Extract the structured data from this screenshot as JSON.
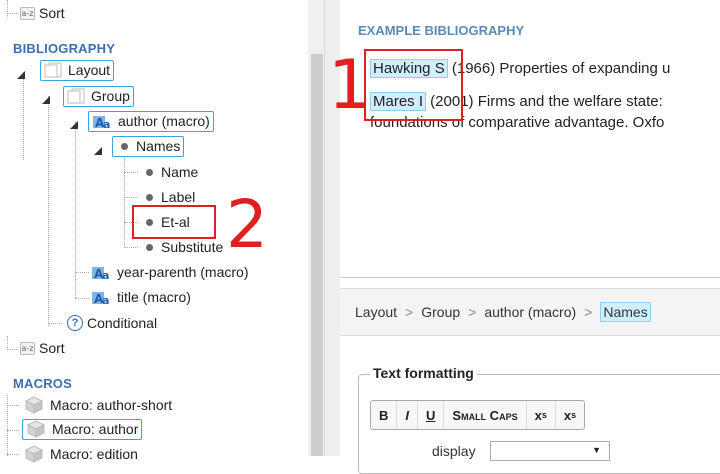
{
  "tree": {
    "sort_top": "Sort",
    "bibliography_title": "BIBLIOGRAPHY",
    "layout": "Layout",
    "group": "Group",
    "author_macro": "author (macro)",
    "names": "Names",
    "name": "Name",
    "label": "Label",
    "et_al": "Et-al",
    "substitute": "Substitute",
    "year_parenth": "year-parenth (macro)",
    "title_macro": "title (macro)",
    "conditional": "Conditional",
    "sort_bottom": "Sort",
    "macros_title": "MACROS",
    "macro_author_short": "Macro: author-short",
    "macro_author": "Macro: author",
    "macro_edition": "Macro: edition",
    "az_icon_text": "a-z",
    "help_icon_text": "?"
  },
  "preview": {
    "title": "EXAMPLE BIBLIOGRAPHY",
    "entries": [
      {
        "author": "Hawking S",
        "rest": " (1966) Properties of expanding u"
      },
      {
        "author": "Mares I",
        "rest": " (2001) Firms and the welfare state: "
      }
    ],
    "continuation": "foundations of comparative advantage. Oxfo"
  },
  "breadcrumb": {
    "items": [
      "Layout",
      "Group",
      "author (macro)",
      "Names"
    ],
    "separator": ">"
  },
  "editor": {
    "legend": "Text formatting",
    "buttons": {
      "bold": "B",
      "italic": "I",
      "underline": "U",
      "small_caps": "Small Caps",
      "superscript": "x",
      "superscript_mark": "s",
      "subscript": "x",
      "subscript_mark": "s"
    },
    "display_label": "display",
    "display_value": "",
    "dropdown_arrow": "▼"
  },
  "annotations": {
    "one": "1",
    "two": "2",
    "color": "#e02020"
  },
  "colors": {
    "selection_border": "#35a7e0",
    "highlight": "#cfeeff",
    "section_title": "#3d6fb0"
  }
}
